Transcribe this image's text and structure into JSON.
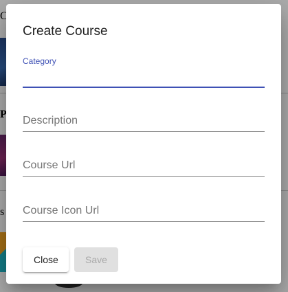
{
  "background": {
    "fragments": [
      "C",
      "Pr",
      "s"
    ]
  },
  "dialog": {
    "title": "Create Course",
    "fields": [
      {
        "label": "Category",
        "value": "",
        "placeholder": "",
        "focused": true
      },
      {
        "label": "Description",
        "value": "",
        "placeholder": "Description",
        "focused": false
      },
      {
        "label": "Course Url",
        "value": "",
        "placeholder": "Course Url",
        "focused": false
      },
      {
        "label": "Course Icon Url",
        "value": "",
        "placeholder": "Course Icon Url",
        "focused": false
      }
    ],
    "buttons": {
      "close_label": "Close",
      "save_label": "Save",
      "save_disabled": true
    }
  },
  "colors": {
    "accent": "#3f51b5",
    "disabled_bg": "#e0e0e0",
    "disabled_text": "#a8a8a8"
  }
}
